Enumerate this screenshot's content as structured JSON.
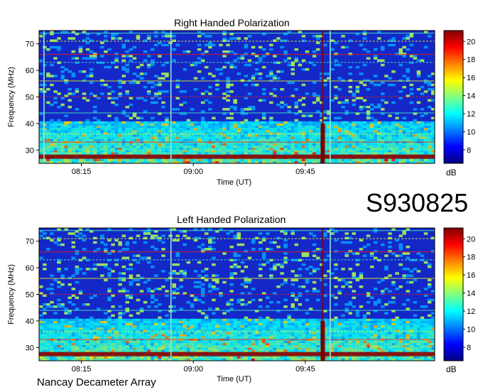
{
  "figure_id": "S930825",
  "footer_text": "Nancay Decameter Array",
  "colors": {
    "background_blue": "#1428c8",
    "band_red": "#8b0000",
    "burst_dark_red": "#7a0000",
    "vertical_line_cyan": "#8fe8d8"
  },
  "chart_data": [
    {
      "type": "heatmap",
      "title": "Right Handed Polarization",
      "xlabel": "Time (UT)",
      "ylabel": "Frequency (MHz)",
      "x_ticks": [
        "08:15",
        "09:00",
        "09:45"
      ],
      "y_ticks": [
        30,
        40,
        50,
        60,
        70
      ],
      "xlim": [
        "07:58",
        "10:37"
      ],
      "ylim": [
        25,
        75
      ],
      "colorbar": {
        "label": "dB",
        "ticks": [
          8,
          10,
          12,
          14,
          16,
          18,
          20
        ],
        "range": [
          6.5,
          21.2
        ],
        "colormap": "jet"
      },
      "features": {
        "strong_band_mhz": 27.5,
        "burst_time": "09:52",
        "vertical_line_times": [
          "08:00",
          "08:51",
          "09:55"
        ],
        "interference_lines_mhz": [
          74,
          71,
          66,
          63,
          56,
          50,
          44,
          36,
          33,
          30
        ]
      }
    },
    {
      "type": "heatmap",
      "title": "Left Handed Polarization",
      "xlabel": "Time (UT)",
      "ylabel": "Frequency (MHz)",
      "x_ticks": [
        "08:15",
        "09:00",
        "09:45"
      ],
      "y_ticks": [
        30,
        40,
        50,
        60,
        70
      ],
      "xlim": [
        "07:58",
        "10:37"
      ],
      "ylim": [
        25,
        75
      ],
      "colorbar": {
        "label": "dB",
        "ticks": [
          8,
          10,
          12,
          14,
          16,
          18,
          20
        ],
        "range": [
          6.5,
          21.2
        ],
        "colormap": "jet"
      },
      "features": {
        "strong_band_mhz": 27.5,
        "burst_time": "09:52",
        "vertical_line_times": [
          "08:51",
          "09:55"
        ],
        "interference_lines_mhz": [
          74,
          71,
          66,
          63,
          56,
          50,
          44,
          36,
          33,
          30
        ]
      }
    }
  ]
}
